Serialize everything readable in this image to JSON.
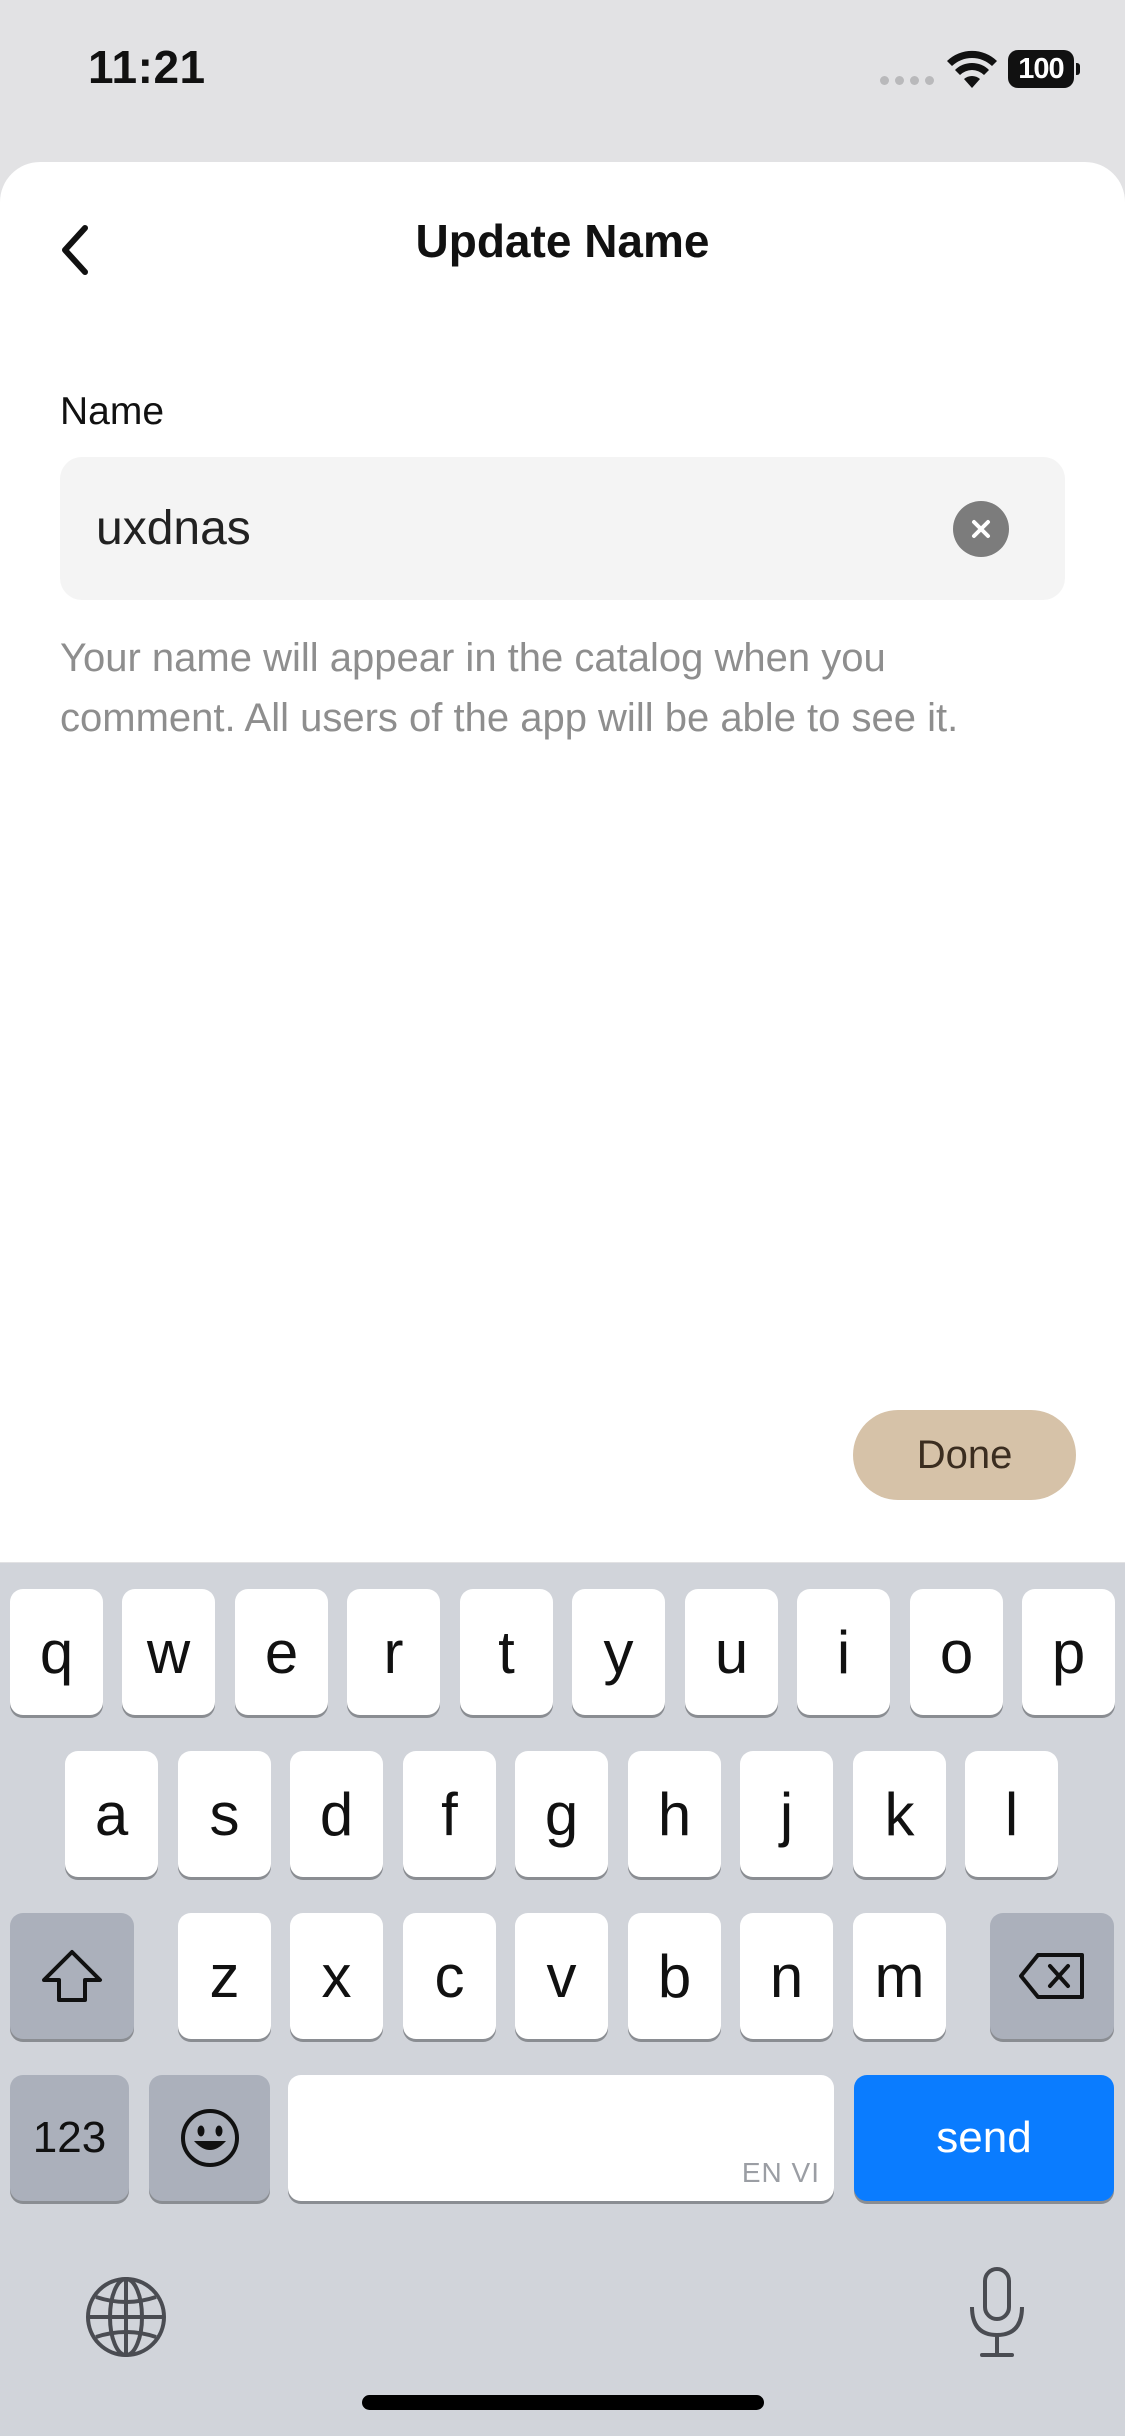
{
  "status_bar": {
    "time": "11:21",
    "battery": "100"
  },
  "header": {
    "title": "Update Name",
    "back_icon": "chevron-left-icon"
  },
  "form": {
    "label": "Name",
    "value": "uxdnas",
    "helper_text": "Your name will appear in the catalog when you comment. All users of the app will be able to see it.",
    "clear_icon": "clear-circle-icon"
  },
  "actions": {
    "done_label": "Done",
    "done_color": "#d6c2a8"
  },
  "keyboard": {
    "row1": [
      "q",
      "w",
      "e",
      "r",
      "t",
      "y",
      "u",
      "i",
      "o",
      "p"
    ],
    "row2": [
      "a",
      "s",
      "d",
      "f",
      "g",
      "h",
      "j",
      "k",
      "l"
    ],
    "row3": [
      "z",
      "x",
      "c",
      "v",
      "b",
      "n",
      "m"
    ],
    "numbers_label": "123",
    "language_tag": "EN VI",
    "send_label": "send",
    "send_color": "#0a7cff",
    "icons": [
      "shift-icon",
      "backspace-icon",
      "emoji-icon",
      "globe-icon",
      "microphone-icon"
    ]
  }
}
